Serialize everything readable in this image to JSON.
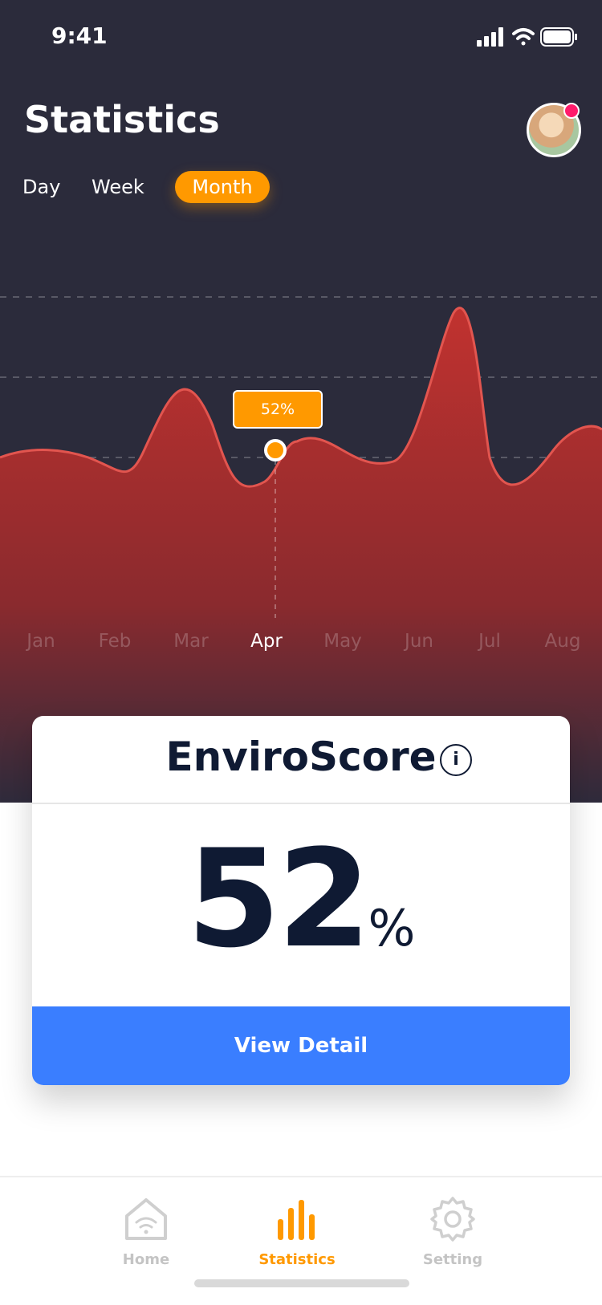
{
  "status_bar": {
    "time": "9:41",
    "icons": [
      "signal-icon",
      "wifi-icon",
      "battery-icon"
    ]
  },
  "header": {
    "title": "Statistics",
    "avatar": "profile-avatar",
    "notification_color": "#ff1b6b"
  },
  "period_tabs": {
    "items": [
      {
        "label": "Day",
        "selected": false
      },
      {
        "label": "Week",
        "selected": false
      },
      {
        "label": "Month",
        "selected": true
      }
    ],
    "accent": "#ff9900"
  },
  "chart_data": {
    "type": "area",
    "x": [
      "Jan",
      "Feb",
      "Mar",
      "Apr",
      "May",
      "Jun",
      "Jul",
      "Aug"
    ],
    "highlight": {
      "category": "Apr",
      "value": 52,
      "label": "52%"
    },
    "values_approx": [
      50,
      47,
      62,
      52,
      49,
      58,
      45,
      56
    ],
    "grid": "dashed-horizontal",
    "fill_color": "#c1322f"
  },
  "enviro_card": {
    "title": "EnviroScore",
    "info_icon": "i",
    "score": "52",
    "unit": "%",
    "button": "View Detail",
    "button_color": "#3a7eff"
  },
  "tabbar": {
    "items": [
      {
        "label": "Home",
        "icon": "home-icon",
        "active": false
      },
      {
        "label": "Statistics",
        "icon": "statistics-icon",
        "active": true
      },
      {
        "label": "Setting",
        "icon": "gear-icon",
        "active": false
      }
    ]
  }
}
